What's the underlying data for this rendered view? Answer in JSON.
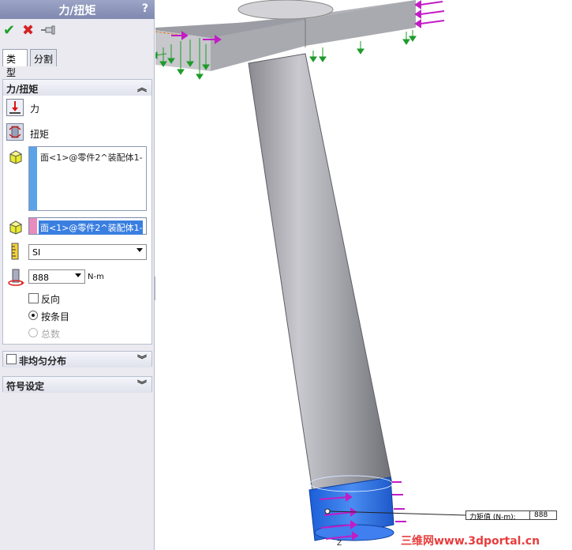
{
  "pm": {
    "title": "力/扭矩",
    "help": "?",
    "tabs": [
      "类型",
      "分割"
    ],
    "group_force": {
      "header": "力/扭矩",
      "force_label": "力",
      "torque_label": "扭矩",
      "faces_selection": "面<1>@零件2^装配体1-",
      "direction_selection": "面<1>@零件2^装配体1-",
      "units": "SI",
      "value": "888",
      "value_unit": "N-m",
      "reverse_label": "反向",
      "per_item_label": "按条目",
      "total_label": "总数"
    },
    "group_nonuniform": {
      "header": "非均匀分布"
    },
    "group_symbol": {
      "header": "符号设定"
    }
  },
  "graphics": {
    "callout_label": "力矩值 (N-m):",
    "callout_value": "888",
    "axis_label": "Z",
    "watermark": "三维网www.3dportal.cn"
  },
  "colors": {
    "accent_blue": "#3a7fe0",
    "selection_pink": "#e88bbd",
    "arrow_green": "#1e9b2a",
    "arrow_magenta": "#c21cc5"
  },
  "icons": {
    "ok": "check-icon",
    "cancel": "close-icon",
    "pin": "pushpin-icon",
    "force": "force-icon",
    "torque": "torque-icon",
    "face": "face-icon",
    "units": "ruler-icon",
    "torque_value": "torque-value-icon"
  }
}
